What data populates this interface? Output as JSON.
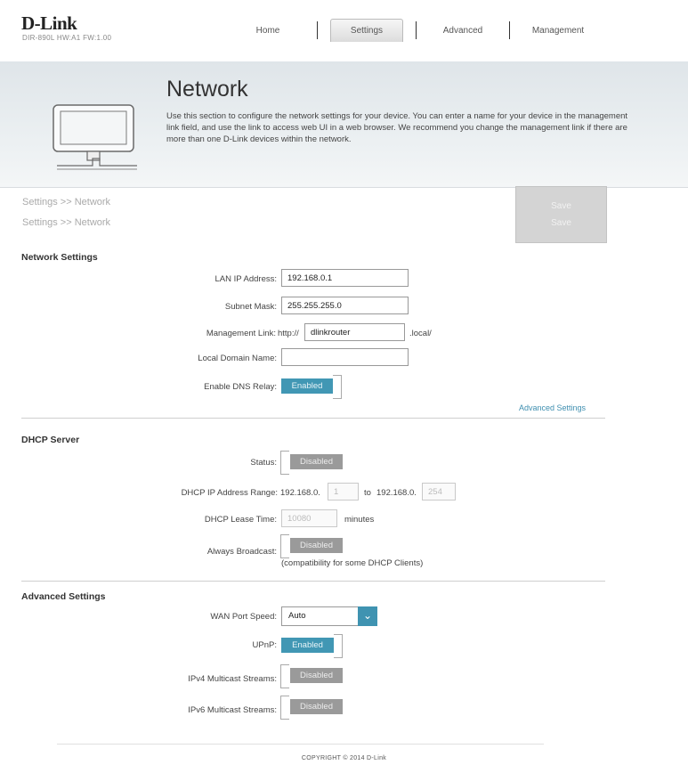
{
  "brand": {
    "logo": "D-Link",
    "model_line": "DIR-890L  HW:A1  FW:1.00"
  },
  "nav": {
    "home": "Home",
    "settings": "Settings",
    "advanced": "Advanced",
    "management": "Management"
  },
  "banner": {
    "title": "Network",
    "description": "Use this section to configure the network settings for your device. You can enter a name for your device in the management link field, and use the link to access web UI in a web browser. We recommend you change the management link if there are more than one D-Link devices within the network."
  },
  "breadcrumbs": {
    "line1": "Settings >> Network",
    "line2": "Settings >> Network"
  },
  "save": {
    "label1": "Save",
    "label2": "Save"
  },
  "network_settings": {
    "title": "Network Settings",
    "lan_ip_label": "LAN IP Address:",
    "lan_ip_value": "192.168.0.1",
    "subnet_label": "Subnet Mask:",
    "subnet_value": "255.255.255.0",
    "mgmt_label": "Management Link:",
    "mgmt_prefix": "http://",
    "mgmt_value": "dlinkrouter",
    "mgmt_suffix": ".local/",
    "domain_label": "Local Domain Name:",
    "domain_value": "",
    "dns_relay_label": "Enable DNS Relay:",
    "dns_relay_state": "Enabled",
    "advanced_link": "Advanced Settings"
  },
  "dhcp_server": {
    "title": "DHCP Server",
    "status_label": "Status:",
    "status_state": "Disabled",
    "range_label": "DHCP IP Address Range:",
    "range_prefix_start": "192.168.0.",
    "range_start": "1",
    "range_to": "to",
    "range_prefix_end": "192.168.0.",
    "range_end": "254",
    "lease_label": "DHCP Lease Time:",
    "lease_value": "10080",
    "lease_unit": "minutes",
    "broadcast_label": "Always Broadcast:",
    "broadcast_state": "Disabled",
    "broadcast_note": "(compatibility for some DHCP Clients)"
  },
  "advanced_settings": {
    "title": "Advanced Settings",
    "wan_speed_label": "WAN Port Speed:",
    "wan_speed_value": "Auto",
    "upnp_label": "UPnP:",
    "upnp_state": "Enabled",
    "ipv4_multicast_label": "IPv4 Multicast Streams:",
    "ipv4_multicast_state": "Disabled",
    "ipv6_multicast_label": "IPv6 Multicast Streams:",
    "ipv6_multicast_state": "Disabled"
  },
  "footer": {
    "copyright": "COPYRIGHT © 2014 D-Link"
  },
  "colors": {
    "accent": "#4197b4",
    "disabled": "#9a9a9a",
    "save_bg": "#d4d4d4"
  },
  "icons": {
    "banner": "computer-monitor-icon",
    "dropdown": "chevron-down-icon"
  }
}
